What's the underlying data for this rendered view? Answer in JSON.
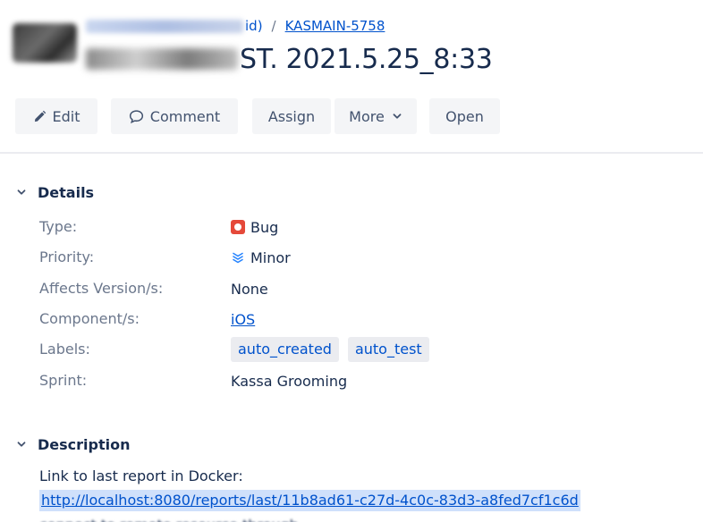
{
  "breadcrumb": {
    "parent_tail": "id)",
    "separator": "/",
    "issue_key": "KASMAIN-5758"
  },
  "issue": {
    "title_visible": "ST. 2021.5.25_8:33"
  },
  "toolbar": {
    "edit_label": "Edit",
    "comment_label": "Comment",
    "assign_label": "Assign",
    "more_label": "More",
    "open_label": "Open"
  },
  "details": {
    "heading": "Details",
    "fields": {
      "type": {
        "label": "Type:",
        "value": "Bug"
      },
      "priority": {
        "label": "Priority:",
        "value": "Minor"
      },
      "affects": {
        "label": "Affects Version/s:",
        "value": "None"
      },
      "component": {
        "label": "Component/s:",
        "value": "iOS"
      },
      "labels": {
        "label": "Labels:",
        "values": [
          "auto_created",
          "auto_test"
        ]
      },
      "sprint": {
        "label": "Sprint:",
        "value": "Kassa Grooming"
      }
    }
  },
  "description": {
    "heading": "Description",
    "line1": "Link to last report in Docker:",
    "link": "http://localhost:8080/reports/last/11b8ad61-c27d-4c0c-83d3-a8fed7cf1c6d",
    "line3_partial": "connect to remote resource through"
  },
  "colors": {
    "link": "#0052cc",
    "bug": "#e5493a",
    "priority_minor": "#2684ff",
    "button_bg": "#f4f5f7"
  },
  "icons": {
    "edit": "pencil-icon",
    "comment": "speech-bubble-icon",
    "more": "chevron-down-icon",
    "section": "chevron-down-icon",
    "type": "bug-icon",
    "priority": "priority-minor-icon"
  }
}
